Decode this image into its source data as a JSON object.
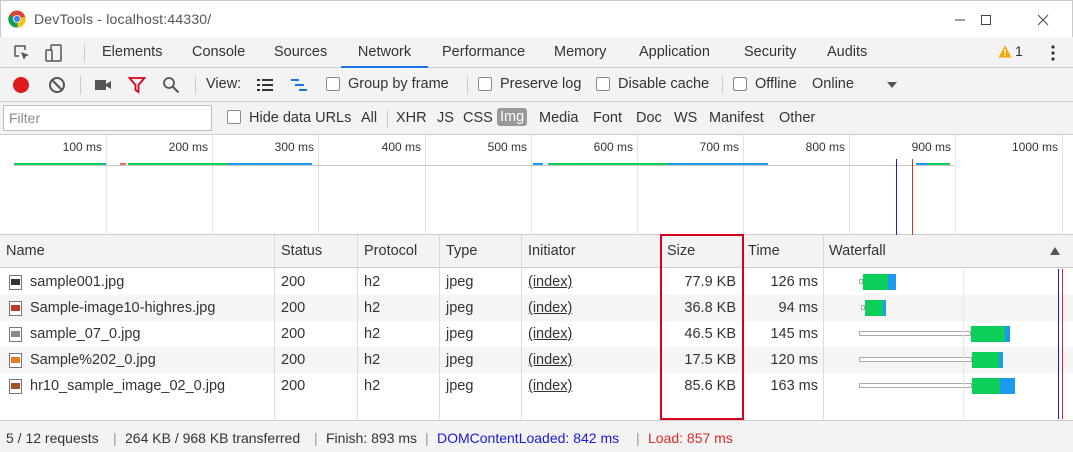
{
  "window": {
    "title": "DevTools - localhost:44330/"
  },
  "tabs": [
    {
      "label": "Elements"
    },
    {
      "label": "Console"
    },
    {
      "label": "Sources"
    },
    {
      "label": "Network"
    },
    {
      "label": "Performance"
    },
    {
      "label": "Memory"
    },
    {
      "label": "Application"
    },
    {
      "label": "Security"
    },
    {
      "label": "Audits"
    }
  ],
  "warnings": {
    "count": "1"
  },
  "toolbar": {
    "view_label": "View:",
    "group_by_frame": "Group by frame",
    "preserve_log": "Preserve log",
    "disable_cache": "Disable cache",
    "offline": "Offline",
    "throttle": "Online"
  },
  "filter": {
    "placeholder": "Filter",
    "hide_data_urls": "Hide data URLs",
    "types": [
      "All",
      "XHR",
      "JS",
      "CSS",
      "Img",
      "Media",
      "Font",
      "Doc",
      "WS",
      "Manifest",
      "Other"
    ],
    "selected_type": "Img"
  },
  "overview": {
    "ticks": [
      "100 ms",
      "200 ms",
      "300 ms",
      "400 ms",
      "500 ms",
      "600 ms",
      "700 ms",
      "800 ms",
      "900 ms",
      "1000 ms"
    ]
  },
  "table": {
    "columns": [
      "Name",
      "Status",
      "Protocol",
      "Type",
      "Initiator",
      "Size",
      "Time",
      "Waterfall"
    ],
    "rows": [
      {
        "name": "sample001.jpg",
        "status": "200",
        "protocol": "h2",
        "type": "jpeg",
        "initiator": "(index)",
        "size": "77.9 KB",
        "time": "126 ms"
      },
      {
        "name": "Sample-image10-highres.jpg",
        "status": "200",
        "protocol": "h2",
        "type": "jpeg",
        "initiator": "(index)",
        "size": "36.8 KB",
        "time": "94 ms"
      },
      {
        "name": "sample_07_0.jpg",
        "status": "200",
        "protocol": "h2",
        "type": "jpeg",
        "initiator": "(index)",
        "size": "46.5 KB",
        "time": "145 ms"
      },
      {
        "name": "Sample%202_0.jpg",
        "status": "200",
        "protocol": "h2",
        "type": "jpeg",
        "initiator": "(index)",
        "size": "17.5 KB",
        "time": "120 ms"
      },
      {
        "name": "hr10_sample_image_02_0.jpg",
        "status": "200",
        "protocol": "h2",
        "type": "jpeg",
        "initiator": "(index)",
        "size": "85.6 KB",
        "time": "163 ms"
      }
    ]
  },
  "status": {
    "requests": "5 / 12 requests",
    "transferred": "264 KB / 968 KB transferred",
    "finish": "Finish: 893 ms",
    "dcl": "DOMContentLoaded: 842 ms",
    "load": "Load: 857 ms"
  },
  "colors": {
    "accent": "#1a73e8",
    "record": "#e0191d",
    "filter_red": "#d9001a",
    "waterfall_green": "#0ccf5a",
    "waterfall_blue": "#1a9bf0",
    "dcl_blue": "#1a1adb",
    "load_red": "#d92b2b",
    "highlight": "#d9001a"
  },
  "icons": [
    "chrome-logo",
    "inspect-icon",
    "device-icon",
    "warning-icon",
    "kebab-menu-icon",
    "record-icon",
    "clear-icon",
    "camera-icon",
    "filter-icon",
    "search-icon",
    "list-view-icon",
    "waterfall-view-icon",
    "dropdown-caret-icon",
    "sort-ascending-icon",
    "image-file-icon"
  ]
}
